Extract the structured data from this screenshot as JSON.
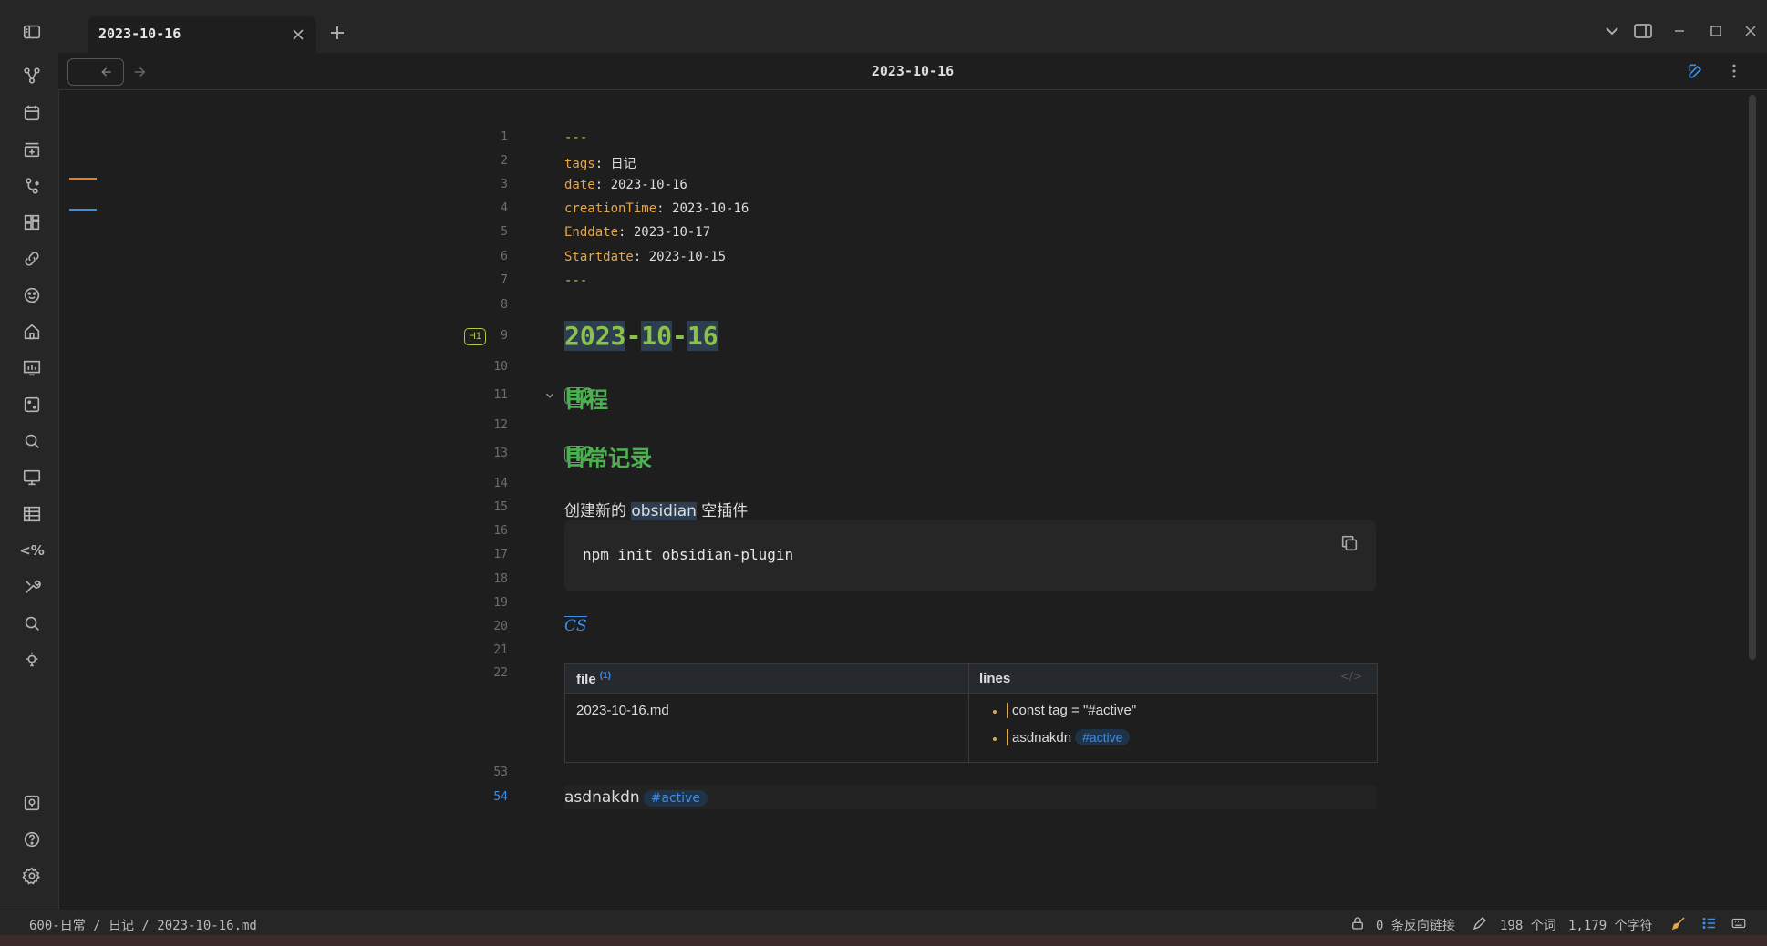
{
  "tab": {
    "title": "2023-10-16"
  },
  "view_header": {
    "title": "2023-10-16"
  },
  "ribbon": {
    "template_label": "<%"
  },
  "editor": {
    "line_numbers": [
      "1",
      "2",
      "3",
      "4",
      "5",
      "6",
      "7",
      "8",
      "9",
      "10",
      "11",
      "12",
      "13",
      "14",
      "15",
      "16",
      "17",
      "18",
      "19",
      "20",
      "21",
      "22",
      "53",
      "54"
    ],
    "frontmatter": {
      "delimiter": "---",
      "fields": [
        {
          "key": "tags",
          "value": "日记"
        },
        {
          "key": "date",
          "value": "2023-10-16"
        },
        {
          "key": "creationTime",
          "value": "2023-10-16"
        },
        {
          "key": "Enddate",
          "value": "2023-10-17"
        },
        {
          "key": "Startdate",
          "value": "2023-10-15"
        }
      ]
    },
    "heading_badges": {
      "h1": "H1",
      "h2": "H2"
    },
    "h1": {
      "parts": [
        "2023",
        "-",
        "10",
        "-",
        "16"
      ]
    },
    "h2_schedule": "日程",
    "h2_daily": "日常记录",
    "paragraph": {
      "before": "创建新的 ",
      "highlight": "obsidian",
      "after": " 空插件"
    },
    "code": "npm init obsidian-plugin",
    "cs_link": "CS",
    "dataview": {
      "headers": {
        "file": "file",
        "file_count": "(1)",
        "lines": "lines",
        "code_toggle": "</>"
      },
      "row": {
        "file": "2023-10-16.md",
        "lines": [
          {
            "text": "const tag = \"#active\"",
            "tag": ""
          },
          {
            "text": "asdnakdn",
            "tag": "#active"
          }
        ]
      }
    },
    "line54": {
      "text": "asdnakdn",
      "tag": "#active"
    }
  },
  "statusbar": {
    "breadcrumb": "600-日常 / 日记 / 2023-10-16.md",
    "backlinks": "0 条反向链接",
    "word_count": "198 个词",
    "char_count": "1,179 个字符"
  },
  "colors": {
    "accent": "#3b8eea",
    "frontmatter_key": "#e5a54b",
    "h1": "#8bc34a",
    "h2": "#4caf50",
    "outline_orange": "#e67e22",
    "outline_blue": "#3b8eea"
  }
}
